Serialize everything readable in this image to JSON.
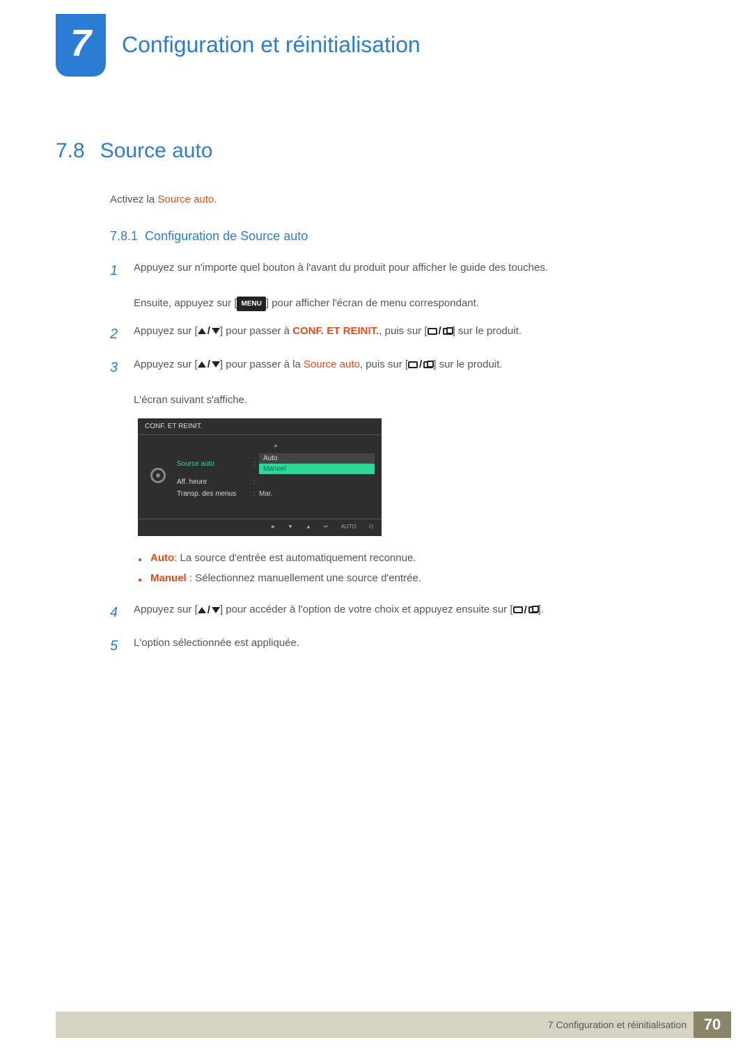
{
  "chapter": {
    "number": "7",
    "title": "Configuration et réinitialisation"
  },
  "section": {
    "number": "7.8",
    "title": "Source auto",
    "intro_prefix": "Activez la ",
    "intro_highlight": "Source auto",
    "intro_suffix": "."
  },
  "subsection": {
    "number": "7.8.1",
    "title": "Configuration de Source auto"
  },
  "steps": {
    "s1_a": "Appuyez sur n'importe quel bouton à l'avant du produit pour afficher le guide des touches.",
    "s1_b_pre": "Ensuite, appuyez sur [",
    "s1_b_menu": "MENU",
    "s1_b_post": "] pour afficher l'écran de menu correspondant.",
    "s2_pre": "Appuyez sur [",
    "s2_mid1": "] pour passer à ",
    "s2_hl": "CONF. ET REINIT.",
    "s2_mid2": ", puis sur [",
    "s2_post": "] sur le produit.",
    "s3_pre": "Appuyez sur [",
    "s3_mid1": "] pour passer à la ",
    "s3_hl": "Source auto",
    "s3_mid2": ", puis sur [",
    "s3_post": "] sur le produit.",
    "s3_below": "L'écran suivant s'affiche.",
    "s4_pre": "Appuyez sur [",
    "s4_mid": "] pour accéder à l'option de votre choix et appuyez ensuite sur [",
    "s4_post": "].",
    "s5": "L'option sélectionnée est appliquée."
  },
  "step_numbers": {
    "n1": "1",
    "n2": "2",
    "n3": "3",
    "n4": "4",
    "n5": "5"
  },
  "osd": {
    "title": "CONF. ET REINIT.",
    "rows": [
      {
        "label": "Source auto",
        "value": ""
      },
      {
        "label": "Aff. heure",
        "value": ""
      },
      {
        "label": "Transp. des menus",
        "value": "Mar."
      }
    ],
    "dropdown": [
      "Auto",
      "Manuel"
    ],
    "footer_auto": "AUTO"
  },
  "bullets": {
    "auto_label": "Auto",
    "auto_text": ": La source d'entrée est automatiquement reconnue.",
    "manuel_label": "Manuel",
    "manuel_text": " : Sélectionnez manuellement une source d'entrée."
  },
  "footer": {
    "text": "7 Configuration et réinitialisation",
    "page": "70"
  }
}
